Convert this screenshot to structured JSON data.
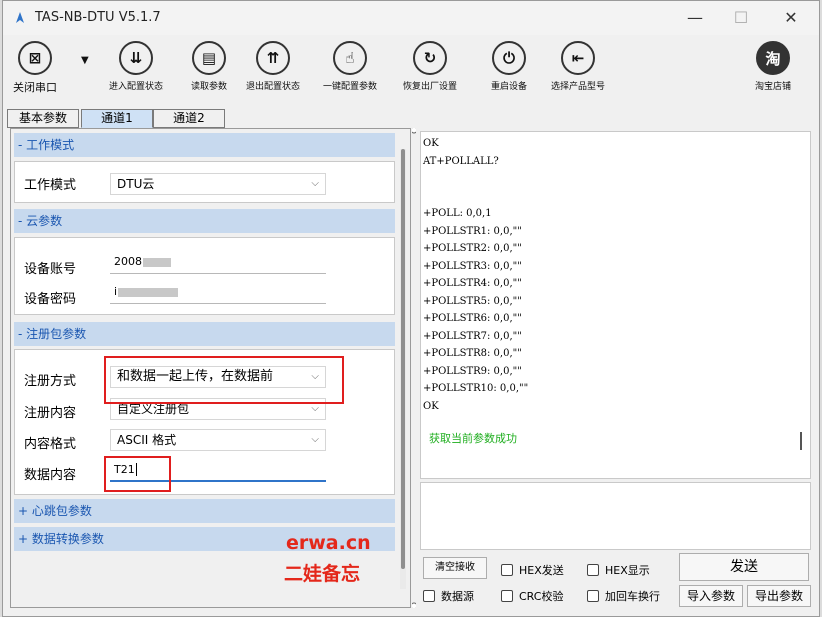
{
  "window": {
    "title": "TAS-NB-DTU V5.1.7"
  },
  "controls": {
    "minimize": "—",
    "maximize": "☐",
    "close": "✕"
  },
  "toolbar": {
    "close_port": "关闭串口",
    "enter_config": "进入配置状态",
    "read_params": "读取参数",
    "exit_config": "退出配置状态",
    "one_key_config": "一键配置参数",
    "factory_reset": "恢复出厂设置",
    "restart": "重启设备",
    "select_model": "选择产品型号",
    "taobao": "淘宝店铺",
    "taobao_glyph": "淘"
  },
  "tabs": [
    "基本参数",
    "通道1",
    "通道2"
  ],
  "sections": {
    "work_mode": {
      "header": "- 工作模式",
      "label": "工作模式",
      "value": "DTU云"
    },
    "cloud": {
      "header": "- 云参数",
      "account_label": "设备账号",
      "account_value": "2008",
      "password_label": "设备密码",
      "password_value": "i"
    },
    "register": {
      "header": "- 注册包参数",
      "method_label": "注册方式",
      "method_value": "和数据一起上传，在数据前",
      "content_label": "注册内容",
      "content_value": "自定义注册包",
      "format_label": "内容格式",
      "format_value": "ASCII 格式",
      "data_label": "数据内容",
      "data_value": "T21"
    },
    "heartbeat": {
      "header": "+ 心跳包参数"
    },
    "data_convert": {
      "header": "+ 数据转换参数"
    }
  },
  "log": {
    "lines_top": [
      "OK",
      "AT+POLLALL?"
    ],
    "lines": [
      "+POLL: 0,0,1",
      "+POLLSTR1: 0,0,\"\"",
      "+POLLSTR2: 0,0,\"\"",
      "+POLLSTR3: 0,0,\"\"",
      "+POLLSTR4: 0,0,\"\"",
      "+POLLSTR5: 0,0,\"\"",
      "+POLLSTR6: 0,0,\"\"",
      "+POLLSTR7: 0,0,\"\"",
      "+POLLSTR8: 0,0,\"\"",
      "+POLLSTR9: 0,0,\"\"",
      "+POLLSTR10: 0,0,\"\"",
      "OK"
    ],
    "success": "获取当前参数成功"
  },
  "bottom": {
    "clear": "清空接收",
    "hex_send": "HEX发送",
    "hex_show": "HEX显示",
    "send": "发送",
    "data_source": "数据源",
    "crc": "CRC校验",
    "add_crlf": "加回车换行",
    "import": "导入参数",
    "export": "导出参数"
  },
  "watermark": {
    "line1": "erwa.cn",
    "line2": "二娃备忘"
  },
  "colors": {
    "accent_blue": "#1a56b0",
    "header_bg": "#c7d9ee",
    "success_green": "#1fae1f",
    "highlight_red": "#e01e1e"
  }
}
